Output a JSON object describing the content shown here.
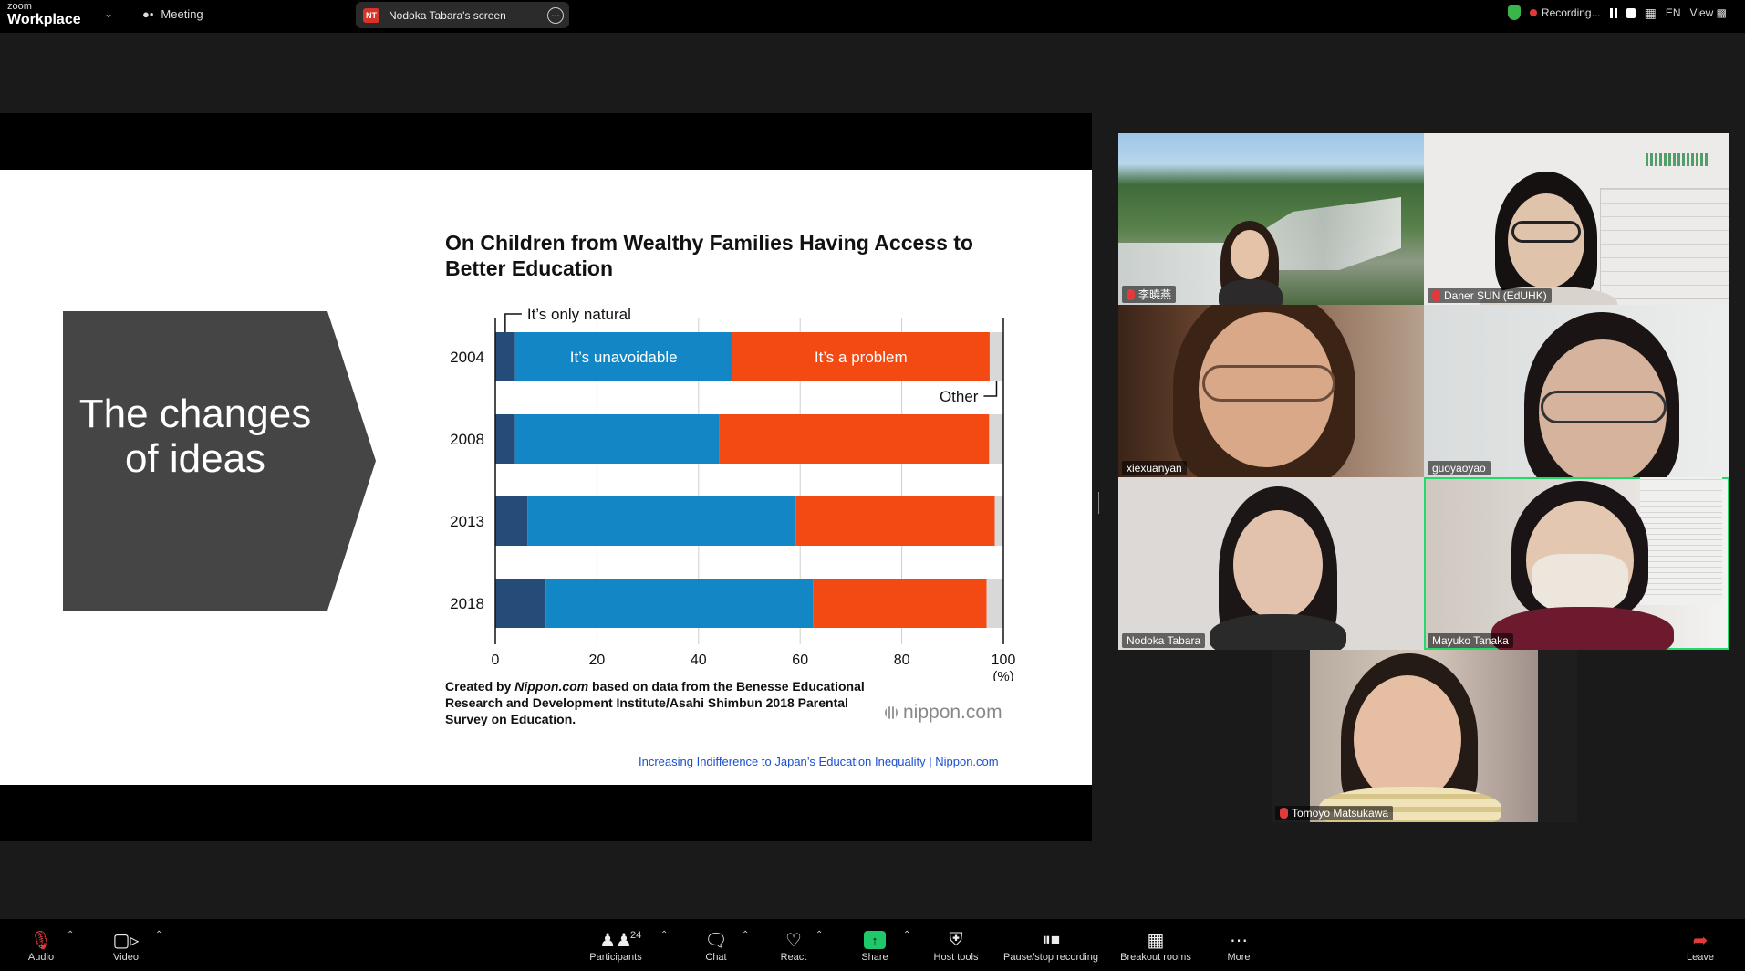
{
  "topbar": {
    "brand_small": "zoom",
    "brand_big": "Workplace",
    "meeting_label": "Meeting",
    "share_initials": "NT",
    "share_label": "Nodoka Tabara's screen",
    "recording_label": "Recording...",
    "language": "EN",
    "view_label": "View"
  },
  "slide": {
    "arrow_text": "The changes of ideas",
    "credit_prefix": "Created by ",
    "credit_site": "Nippon.com",
    "credit_rest": " based on data from the Benesse Educational Research and Development Institute/Asahi Shimbun 2018 Parental Survey on Education.",
    "logo_text": "nippon.com",
    "link_text": "Increasing Indifference to Japan’s Education Inequality | Nippon.com"
  },
  "chart_data": {
    "type": "bar",
    "orientation": "horizontal",
    "stacked": true,
    "title": "On Children from Wealthy Families Having Access to Better Education",
    "categories": [
      "2004",
      "2008",
      "2013",
      "2018"
    ],
    "series": [
      {
        "name": "It’s only natural",
        "color": "#254c79",
        "values": [
          3.9,
          3.9,
          6.3,
          9.9
        ]
      },
      {
        "name": "It’s unavoidable",
        "color": "#1387c5",
        "values": [
          42.7,
          40.1,
          52.8,
          52.6
        ]
      },
      {
        "name": "It’s a problem",
        "color": "#f24a12",
        "values": [
          50.7,
          53.2,
          39.2,
          34.2
        ]
      },
      {
        "name": "Other",
        "color": "#d8d8d8",
        "values": [
          2.7,
          2.8,
          1.7,
          3.3
        ]
      }
    ],
    "xticks": [
      "0",
      "20",
      "40",
      "60",
      "80",
      "100"
    ],
    "xunit": "(%)",
    "xlim": [
      0,
      100
    ],
    "grid": true
  },
  "participants": [
    {
      "name": "李曉燕",
      "muted": true
    },
    {
      "name": "Daner SUN (EdUHK)",
      "muted": true
    },
    {
      "name": "xiexuanyan",
      "muted": false
    },
    {
      "name": "guoyaoyao",
      "muted": false
    },
    {
      "name": "Nodoka Tabara",
      "muted": false
    },
    {
      "name": "Mayuko Tanaka",
      "muted": false
    },
    {
      "name": "Tomoyo Matsukawa",
      "muted": true
    }
  ],
  "toolbar": {
    "audio": "Audio",
    "video": "Video",
    "participants": "Participants",
    "participant_count": "24",
    "chat": "Chat",
    "react": "React",
    "share": "Share",
    "host_tools": "Host tools",
    "pause_recording": "Pause/stop recording",
    "breakout": "Breakout rooms",
    "more": "More",
    "leave": "Leave"
  }
}
